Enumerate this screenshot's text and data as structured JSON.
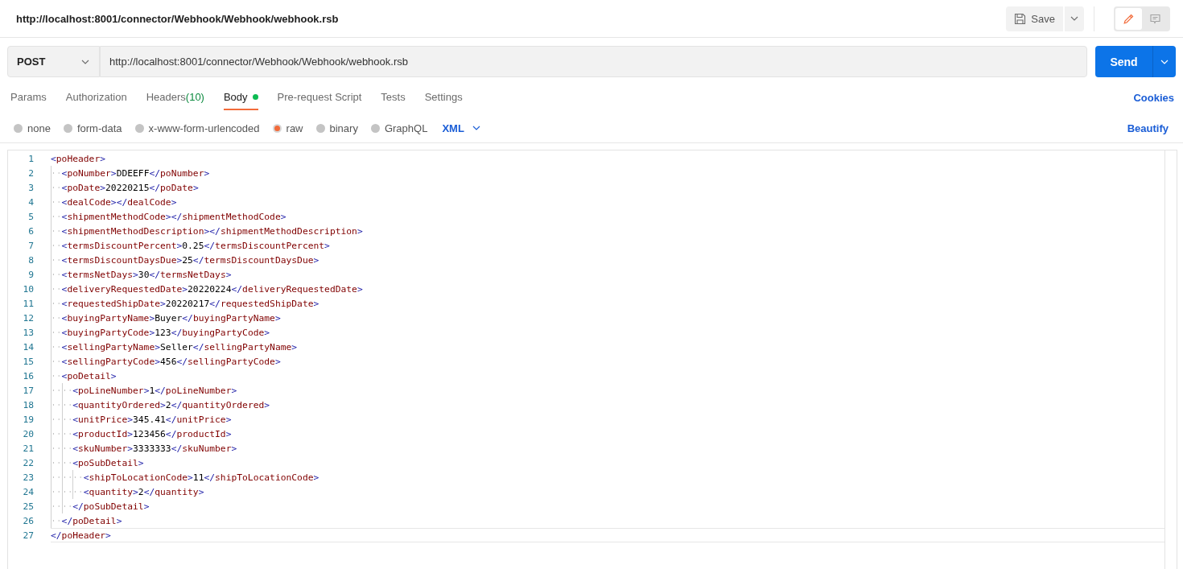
{
  "header": {
    "title": "http://localhost:8001/connector/Webhook/Webhook/webhook.rsb",
    "save_label": "Save",
    "modes": [
      {
        "kind": "edit",
        "selected": true
      },
      {
        "kind": "comments",
        "selected": false
      }
    ]
  },
  "request": {
    "method": "POST",
    "url": "http://localhost:8001/connector/Webhook/Webhook/webhook.rsb",
    "send_label": "Send"
  },
  "tabs": [
    {
      "label": "Params",
      "selected": false
    },
    {
      "label": "Authorization",
      "selected": false
    },
    {
      "label": "Headers",
      "count": "(10)",
      "selected": false
    },
    {
      "label": "Body",
      "has_content": true,
      "selected": true
    },
    {
      "label": "Pre-request Script",
      "selected": false
    },
    {
      "label": "Tests",
      "selected": false
    },
    {
      "label": "Settings",
      "selected": false
    }
  ],
  "cookies_link": "Cookies",
  "body_types": [
    {
      "label": "none",
      "selected": false
    },
    {
      "label": "form-data",
      "selected": false
    },
    {
      "label": "x-www-form-urlencoded",
      "selected": false
    },
    {
      "label": "raw",
      "selected": true
    },
    {
      "label": "binary",
      "selected": false
    },
    {
      "label": "GraphQL",
      "selected": false
    }
  ],
  "format": "XML",
  "beautify_link": "Beautify",
  "editor": {
    "lines": [
      {
        "number": "1",
        "text": "<poHeader>",
        "active": false
      },
      {
        "number": "2",
        "text": "  <poNumber>DDEEFF</poNumber>",
        "active": false
      },
      {
        "number": "3",
        "text": "  <poDate>20220215</poDate>",
        "active": false
      },
      {
        "number": "4",
        "text": "  <dealCode></dealCode>",
        "active": false
      },
      {
        "number": "5",
        "text": "  <shipmentMethodCode></shipmentMethodCode>",
        "active": false
      },
      {
        "number": "6",
        "text": "  <shipmentMethodDescription></shipmentMethodDescription>",
        "active": false
      },
      {
        "number": "7",
        "text": "  <termsDiscountPercent>0.25</termsDiscountPercent>",
        "active": false
      },
      {
        "number": "8",
        "text": "  <termsDiscountDaysDue>25</termsDiscountDaysDue>",
        "active": false
      },
      {
        "number": "9",
        "text": "  <termsNetDays>30</termsNetDays>",
        "active": false
      },
      {
        "number": "10",
        "text": "  <deliveryRequestedDate>20220224</deliveryRequestedDate>",
        "active": false
      },
      {
        "number": "11",
        "text": "  <requestedShipDate>20220217</requestedShipDate>",
        "active": false
      },
      {
        "number": "12",
        "text": "  <buyingPartyName>Buyer</buyingPartyName>",
        "active": false
      },
      {
        "number": "13",
        "text": "  <buyingPartyCode>123</buyingPartyCode>",
        "active": false
      },
      {
        "number": "14",
        "text": "  <sellingPartyName>Seller</sellingPartyName>",
        "active": false
      },
      {
        "number": "15",
        "text": "  <sellingPartyCode>456</sellingPartyCode>",
        "active": false
      },
      {
        "number": "16",
        "text": "  <poDetail>",
        "active": false
      },
      {
        "number": "17",
        "text": "    <poLineNumber>1</poLineNumber>",
        "active": false
      },
      {
        "number": "18",
        "text": "    <quantityOrdered>2</quantityOrdered>",
        "active": false
      },
      {
        "number": "19",
        "text": "    <unitPrice>345.41</unitPrice>",
        "active": false
      },
      {
        "number": "20",
        "text": "    <productId>123456</productId>",
        "active": false
      },
      {
        "number": "21",
        "text": "    <skuNumber>3333333</skuNumber>",
        "active": false
      },
      {
        "number": "22",
        "text": "    <poSubDetail>",
        "active": false
      },
      {
        "number": "23",
        "text": "      <shipToLocationCode>11</shipToLocationCode>",
        "active": false
      },
      {
        "number": "24",
        "text": "      <quantity>2</quantity>",
        "active": false
      },
      {
        "number": "25",
        "text": "    </poSubDetail>",
        "active": false
      },
      {
        "number": "26",
        "text": "  </poDetail>",
        "active": false
      },
      {
        "number": "27",
        "text": "</poHeader>",
        "active": true
      }
    ]
  }
}
